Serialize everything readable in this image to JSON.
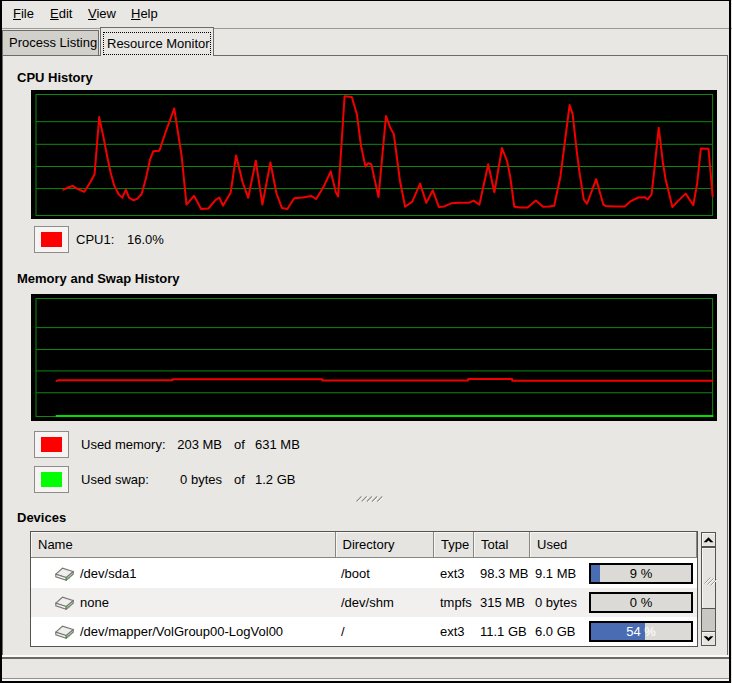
{
  "menu": {
    "items": [
      {
        "label": "File",
        "mnemonic": "F"
      },
      {
        "label": "Edit",
        "mnemonic": "E"
      },
      {
        "label": "View",
        "mnemonic": "V"
      },
      {
        "label": "Help",
        "mnemonic": "H"
      }
    ]
  },
  "tabs": {
    "inactive": "Process Listing",
    "active": "Resource Monitor"
  },
  "cpu_section": {
    "title": "CPU History",
    "legend": {
      "label": "CPU1:",
      "value": "16.0%",
      "swatch_color": "#ff0000"
    }
  },
  "memory_section": {
    "title": "Memory and Swap History",
    "legend": [
      {
        "label": "Used memory:",
        "value": "203 MB",
        "of": "of",
        "total": "631 MB",
        "swatch_color": "#ff0000"
      },
      {
        "label": "Used swap:",
        "value": "0 bytes",
        "of": "of",
        "total": "1.2 GB",
        "swatch_color": "#00ff00"
      }
    ]
  },
  "devices": {
    "title": "Devices",
    "columns": [
      "Name",
      "Directory",
      "Type",
      "Total",
      "Used"
    ],
    "rows": [
      {
        "name": "/dev/sda1",
        "directory": "/boot",
        "type": "ext3",
        "total": "98.3 MB",
        "used": "9.1 MB",
        "pct": 9,
        "pct_label": "9 %",
        "text_color": "#000000"
      },
      {
        "name": "none",
        "directory": "/dev/shm",
        "type": "tmpfs",
        "total": "315 MB",
        "used": "0 bytes",
        "pct": 0,
        "pct_label": "0 %",
        "text_color": "#000000"
      },
      {
        "name": "/dev/mapper/VolGroup00-LogVol00",
        "directory": "/",
        "type": "ext3",
        "total": "11.1 GB",
        "used": "6.0 GB",
        "pct": 54,
        "pct_label": "54 %",
        "text_color": "#ffffff"
      }
    ],
    "progress_fill_color": "#4a6cb2"
  },
  "chart_data": [
    {
      "id": "cpu",
      "type": "line",
      "title": "CPU History",
      "ylim": [
        0,
        100
      ],
      "grid": {
        "hlines_frac": [
          0.2248,
          0.4116,
          0.595,
          0.7777
        ],
        "color": "#0d8a0d",
        "bg": "#000000"
      },
      "series": [
        {
          "name": "CPU1",
          "color": "#f20000",
          "unit": "%",
          "current": 16.0,
          "points": [
            [
              4.06,
              21.4
            ],
            [
              4.74,
              23.1
            ],
            [
              5.42,
              24.5
            ],
            [
              6.16,
              21.8
            ],
            [
              7.16,
              19.6
            ],
            [
              8.09,
              28.1
            ],
            [
              8.66,
              34.1
            ],
            [
              9.34,
              81.3
            ],
            [
              10.01,
              63.7
            ],
            [
              10.49,
              49.6
            ],
            [
              11.02,
              35.5
            ],
            [
              11.57,
              24.5
            ],
            [
              12.2,
              17.8
            ],
            [
              12.75,
              14.7
            ],
            [
              13.28,
              21.4
            ],
            [
              13.75,
              14.7
            ],
            [
              14.43,
              12.6
            ],
            [
              14.99,
              14.0
            ],
            [
              15.61,
              17.8
            ],
            [
              16.23,
              30.2
            ],
            [
              16.85,
              46.1
            ],
            [
              17.33,
              53.1
            ],
            [
              18.23,
              53.5
            ],
            [
              19.28,
              70.7
            ],
            [
              20.43,
              88.4
            ],
            [
              21.52,
              49.6
            ],
            [
              22.25,
              9.0
            ],
            [
              23.35,
              16.3
            ],
            [
              24.42,
              5.4
            ],
            [
              25.48,
              5.8
            ],
            [
              26.51,
              12.7
            ],
            [
              27.09,
              14.9
            ],
            [
              27.64,
              8.1
            ],
            [
              28.77,
              19.1
            ],
            [
              29.57,
              49.7
            ],
            [
              30.55,
              27.3
            ],
            [
              31.36,
              14.6
            ],
            [
              32.48,
              45.3
            ],
            [
              33.46,
              9.0
            ],
            [
              34.65,
              43.8
            ],
            [
              35.55,
              18.2
            ],
            [
              36.35,
              6.3
            ],
            [
              37.16,
              5.4
            ],
            [
              38.14,
              14.2
            ],
            [
              39.42,
              14.9
            ],
            [
              40.71,
              16.0
            ],
            [
              41.42,
              13.6
            ],
            [
              42.5,
              23.7
            ],
            [
              43.56,
              36.5
            ],
            [
              44.33,
              19.1
            ],
            [
              44.65,
              15.7
            ],
            [
              45.61,
              98.5
            ],
            [
              46.68,
              97.9
            ],
            [
              47.43,
              83.6
            ],
            [
              48.04,
              57.8
            ],
            [
              48.7,
              40.3
            ],
            [
              49.1,
              43.2
            ],
            [
              49.56,
              42.4
            ],
            [
              50.62,
              15.2
            ],
            [
              51.73,
              82.2
            ],
            [
              52.36,
              72.4
            ],
            [
              52.88,
              67.3
            ],
            [
              53.8,
              28.6
            ],
            [
              54.55,
              7.2
            ],
            [
              55.61,
              11.5
            ],
            [
              56.77,
              26.4
            ],
            [
              57.68,
              10.4
            ],
            [
              58.64,
              20.8
            ],
            [
              59.54,
              7.1
            ],
            [
              60.34,
              7.5
            ],
            [
              61.36,
              10.1
            ],
            [
              62.7,
              10.6
            ],
            [
              64.03,
              10.6
            ],
            [
              64.68,
              12.3
            ],
            [
              65.54,
              8.9
            ],
            [
              66.84,
              42.4
            ],
            [
              67.75,
              19.2
            ],
            [
              68.88,
              55.8
            ],
            [
              69.63,
              45.0
            ],
            [
              70.09,
              32.1
            ],
            [
              70.69,
              7.2
            ],
            [
              71.57,
              6.6
            ],
            [
              72.66,
              6.6
            ],
            [
              73.87,
              12.3
            ],
            [
              74.93,
              7.2
            ],
            [
              75.85,
              7.5
            ],
            [
              76.59,
              8.0
            ],
            [
              77.5,
              32.1
            ],
            [
              78.86,
              91.3
            ],
            [
              79.32,
              83.6
            ],
            [
              79.93,
              52.7
            ],
            [
              80.37,
              33.8
            ],
            [
              80.97,
              13.1
            ],
            [
              81.43,
              9.7
            ],
            [
              82.79,
              30.0
            ],
            [
              83.86,
              8.9
            ],
            [
              84.22,
              7.8
            ],
            [
              85.6,
              7.5
            ],
            [
              87.03,
              7.5
            ],
            [
              87.87,
              11.7
            ],
            [
              89.0,
              14.9
            ],
            [
              89.99,
              15.0
            ],
            [
              90.4,
              13.3
            ],
            [
              90.97,
              17.3
            ],
            [
              91.39,
              37.3
            ],
            [
              92.04,
              72.6
            ],
            [
              92.66,
              43.6
            ],
            [
              93.07,
              29.3
            ],
            [
              94.06,
              7.0
            ],
            [
              94.9,
              12.1
            ],
            [
              96.03,
              18.1
            ],
            [
              97.15,
              8.5
            ],
            [
              97.71,
              26.1
            ],
            [
              98.27,
              55.4
            ],
            [
              99.39,
              55.2
            ],
            [
              99.68,
              37.3
            ],
            [
              100,
              16.0
            ]
          ]
        }
      ]
    },
    {
      "id": "mem",
      "type": "line",
      "title": "Memory and Swap History",
      "ylim": [
        0,
        100
      ],
      "grid": {
        "hlines_frac": [
          0.2468,
          0.432,
          0.6137,
          0.7989
        ],
        "color": "#0d8a0d",
        "bg": "#000000"
      },
      "series": [
        {
          "name": "Used memory",
          "color": "#f20000",
          "current": "203 MB of 631 MB",
          "points": [
            [
              3.03,
              30.2
            ],
            [
              3.32,
              30.7
            ],
            [
              20.16,
              30.7
            ],
            [
              20.16,
              31.5
            ],
            [
              42.32,
              31.5
            ],
            [
              42.32,
              30.4
            ],
            [
              63.88,
              30.4
            ],
            [
              63.88,
              31.7
            ],
            [
              70.38,
              31.7
            ],
            [
              70.38,
              30.3
            ],
            [
              100,
              30.3
            ]
          ]
        },
        {
          "name": "Used swap",
          "color": "#00e000",
          "current": "0 bytes of 1.2 GB",
          "points": [
            [
              3.03,
              0.5
            ],
            [
              100,
              0.5
            ]
          ]
        }
      ]
    }
  ]
}
